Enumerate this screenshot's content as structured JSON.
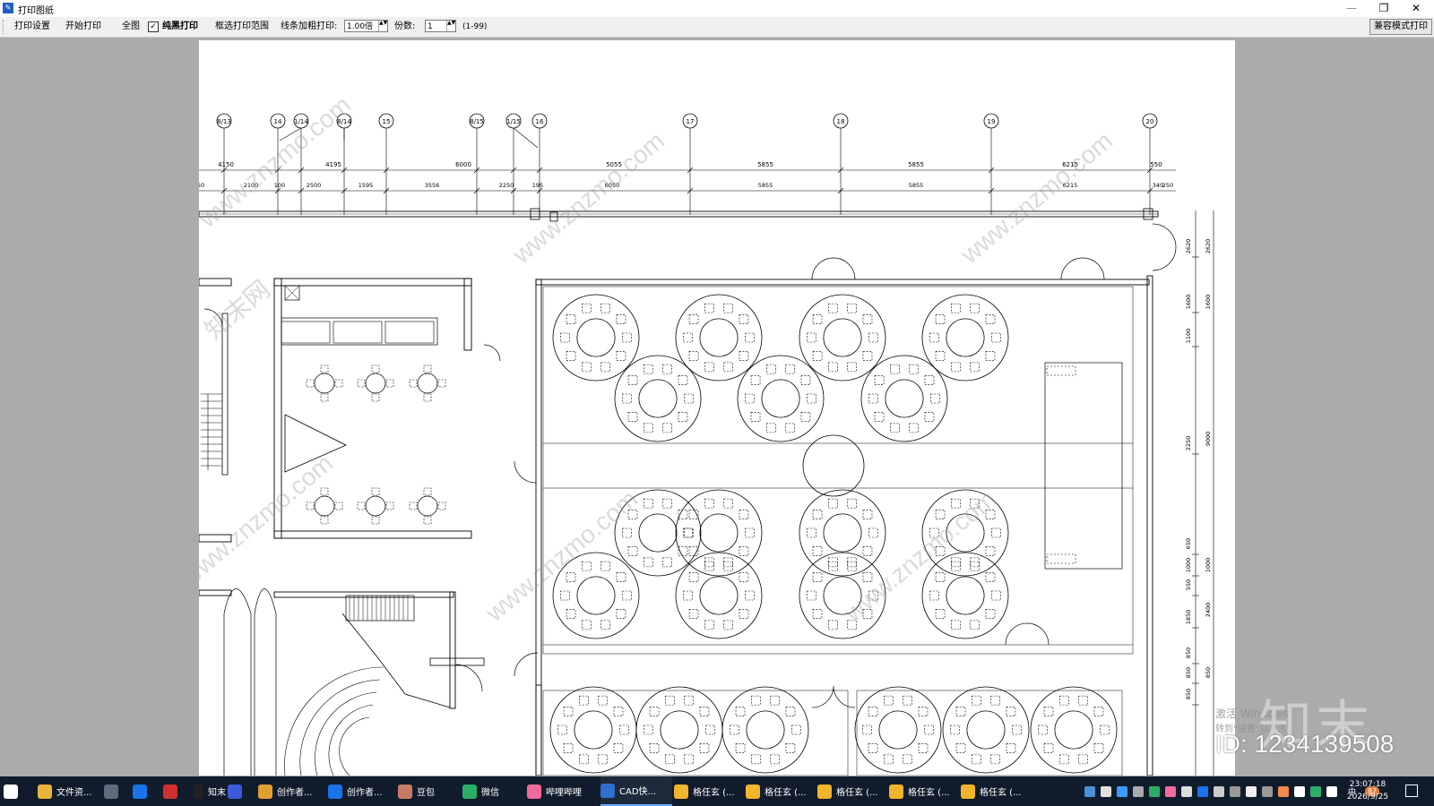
{
  "window": {
    "title": "打印图纸",
    "app_icon": "print-app-icon",
    "restore_glyph": "❐",
    "close_glyph": "✕",
    "minimize_glyph": "—"
  },
  "toolbar": {
    "print_settings": "打印设置",
    "start_print": "开始打印",
    "full_view": "全图",
    "pure_black_checked": true,
    "pure_black_check_glyph": "✓",
    "pure_black": "纯黑打印",
    "select_range": "框选打印范围",
    "line_thicken_label": "线条加粗打印:",
    "line_thicken_value": "1.00倍",
    "copies_label": "份数:",
    "copies_value": "1",
    "copies_range": "(1-99)",
    "compat_mode": "兼容模式打印",
    "spin_arrows": "▲▼"
  },
  "drawing": {
    "grid_labels": [
      "8/13",
      "14",
      "1/14",
      "8/14",
      "15",
      "8/15",
      "1/15",
      "16",
      "17",
      "18",
      "19",
      "20"
    ],
    "dims_top": [
      "4150",
      "4195",
      "6000",
      "5055",
      "5855",
      "5855",
      "6215",
      "550"
    ],
    "dims_bottom": [
      "50",
      "2100",
      "100",
      "2500",
      "1595",
      "3556",
      "2250",
      "195",
      "6050",
      "5855",
      "5855",
      "6215",
      "340",
      "250"
    ],
    "dims_right_inner": [
      "2620",
      "1600",
      "1100",
      "2250",
      "650",
      "1000",
      "550",
      "1850",
      "850",
      "850",
      "850"
    ],
    "dims_right_outer": [
      "2620",
      "1600",
      "9000",
      "1000",
      "2400",
      "850"
    ]
  },
  "watermark": {
    "text": "www.znzmo.com",
    "cn": "知末网"
  },
  "overlay": {
    "logo": "知末",
    "id": "ID: 1234139508",
    "activate": "激活 Windows",
    "activate_sub": "转到\"设置\"以激活"
  },
  "taskbar": {
    "items": [
      {
        "label": "",
        "icon": "windows-start-icon",
        "color": "#ffffff"
      },
      {
        "label": "文件资...",
        "icon": "file-explorer-icon",
        "color": "#e8b53a"
      },
      {
        "label": "",
        "icon": "calculator-icon",
        "color": "#5b6b80"
      },
      {
        "label": "",
        "icon": "search-q-icon",
        "color": "#1a73e8"
      },
      {
        "label": "",
        "icon": "acrobat-icon",
        "color": "#d0312d"
      },
      {
        "label": "知末",
        "icon": "znzmo-icon",
        "color": "#222222"
      },
      {
        "label": "",
        "icon": "illustrator-icon",
        "color": "#3b5bdb"
      },
      {
        "label": "创作者...",
        "icon": "chrome-icon",
        "color": "#e0a030"
      },
      {
        "label": "创作者...",
        "icon": "browser-q-icon",
        "color": "#1a73e8"
      },
      {
        "label": "豆包",
        "icon": "doubao-icon",
        "color": "#c77b63"
      },
      {
        "label": "微信",
        "icon": "wechat-icon",
        "color": "#2aae67"
      },
      {
        "label": "哔哩哔哩",
        "icon": "bilibili-icon",
        "color": "#f06a9b"
      },
      {
        "label": "CAD快...",
        "icon": "cad-fast-icon",
        "color": "#2f6fd0"
      },
      {
        "label": "格任玄 (...",
        "icon": "gerenxuan-icon",
        "color": "#f0b52a"
      },
      {
        "label": "格任玄 (...",
        "icon": "gerenxuan-icon",
        "color": "#f0b52a"
      },
      {
        "label": "格任玄 (...",
        "icon": "gerenxuan-icon",
        "color": "#f0b52a"
      },
      {
        "label": "格任玄 (...",
        "icon": "gerenxuan-icon",
        "color": "#f0b52a"
      },
      {
        "label": "格任玄 (...",
        "icon": "gerenxuan-icon",
        "color": "#f0b52a"
      }
    ],
    "tray_lang": "中",
    "tray_badge": "87",
    "time": "23:07:18",
    "date": "2026/9/25"
  }
}
